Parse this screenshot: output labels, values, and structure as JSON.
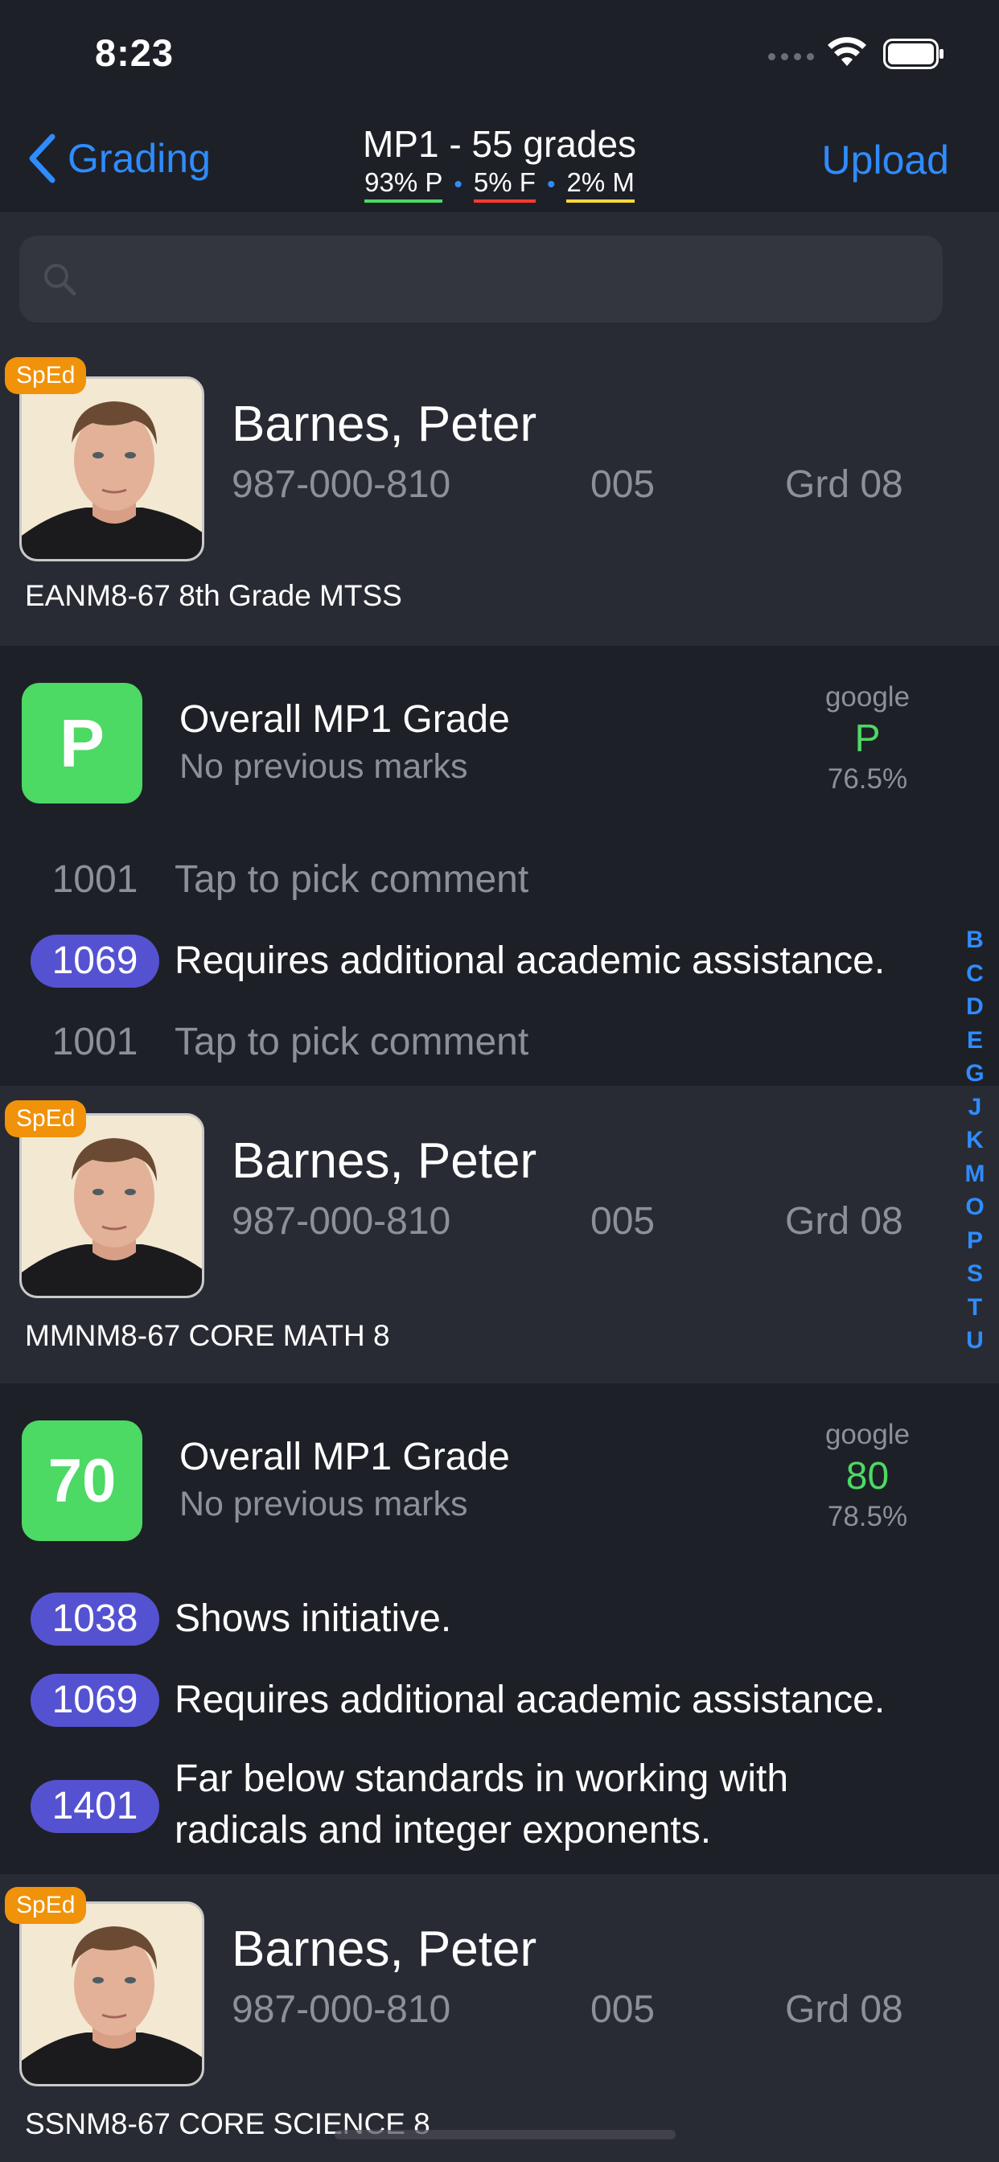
{
  "status_bar": {
    "time": "8:23"
  },
  "nav": {
    "back_label": "Grading",
    "title": "MP1 - 55 grades",
    "stat_p": "93% P",
    "stat_f": "5% F",
    "stat_m": "2% M",
    "dot": "•",
    "upload_label": "Upload"
  },
  "search": {
    "placeholder": ""
  },
  "students": [
    {
      "badge": "SpEd",
      "name": "Barnes, Peter",
      "id": "987-000-810",
      "section": "005",
      "grade_level": "Grd 08",
      "course": "EANM8-67 8th Grade MTSS",
      "grade": "P",
      "grade_title": "Overall MP1 Grade",
      "grade_sub": "No previous marks",
      "google_label": "google",
      "google_grade": "P",
      "google_pct": "76.5%",
      "comments": [
        {
          "code": "1001",
          "text": "Tap to pick comment",
          "selected": false
        },
        {
          "code": "1069",
          "text": "Requires additional academic assistance.",
          "selected": true
        },
        {
          "code": "1001",
          "text": "Tap to pick comment",
          "selected": false
        }
      ]
    },
    {
      "badge": "SpEd",
      "name": "Barnes, Peter",
      "id": "987-000-810",
      "section": "005",
      "grade_level": "Grd 08",
      "course": "MMNM8-67 CORE MATH 8",
      "grade": "70",
      "grade_title": "Overall MP1 Grade",
      "grade_sub": "No previous marks",
      "google_label": "google",
      "google_grade": "80",
      "google_pct": "78.5%",
      "comments": [
        {
          "code": "1038",
          "text": "Shows initiative.",
          "selected": true
        },
        {
          "code": "1069",
          "text": "Requires additional academic assistance.",
          "selected": true
        },
        {
          "code": "1401",
          "text": "Far below standards in working with radicals and integer exponents.",
          "selected": true
        }
      ]
    },
    {
      "badge": "SpEd",
      "name": "Barnes, Peter",
      "id": "987-000-810",
      "section": "005",
      "grade_level": "Grd 08",
      "course": "SSNM8-67 CORE SCIENCE 8"
    }
  ],
  "index_letters": [
    "B",
    "C",
    "D",
    "E",
    "G",
    "J",
    "K",
    "M",
    "O",
    "P",
    "S",
    "T",
    "U"
  ],
  "colors": {
    "accent": "#2f8cff",
    "pass": "#4cd964",
    "fail": "#ff3b30",
    "missing": "#ffd93b",
    "comment_pill": "#5552d1",
    "sped": "#f0920a"
  }
}
